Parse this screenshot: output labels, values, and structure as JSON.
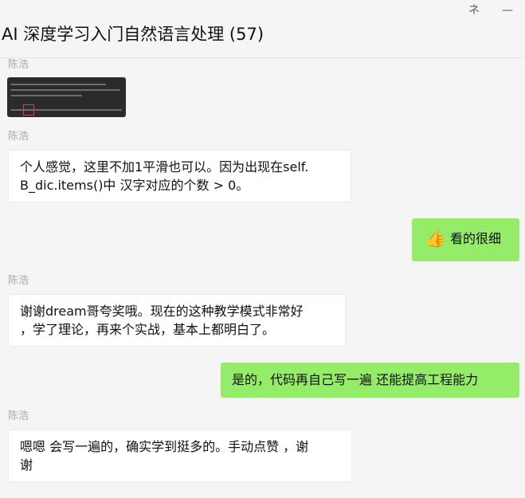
{
  "window": {
    "pin_label": "ネ",
    "minimize_label": "—"
  },
  "chat": {
    "title": "AI 深度学习入门自然语言处理 (57)"
  },
  "messages": [
    {
      "sender": "陈浩",
      "type": "image",
      "image_desc": "code-screenshot"
    },
    {
      "sender": "陈浩",
      "line1": "个人感觉，这里不加1平滑也可以。因为出现在self.",
      "line2": "B_dic.items()中 汉字对应的个数 > 0。"
    },
    {
      "sender": "",
      "icon": "thumbs-up-icon",
      "text": "看的很细"
    },
    {
      "sender": "陈浩",
      "line1": "谢谢dream哥夸奖哦。现在的这种教学模式非常好",
      "line2": "，学了理论，再来个实战，基本上都明白了。"
    },
    {
      "sender": "",
      "text": "是的，代码再自己写一遍 还能提高工程能力"
    },
    {
      "sender": "陈浩",
      "line1": "嗯嗯 会写一遍的，确实学到挺多的。手动点赞 ，谢",
      "line2": "谢"
    }
  ],
  "colors": {
    "bubble_self": "#95ec69",
    "bubble_other": "#ffffff",
    "background": "#f5f5f5"
  }
}
